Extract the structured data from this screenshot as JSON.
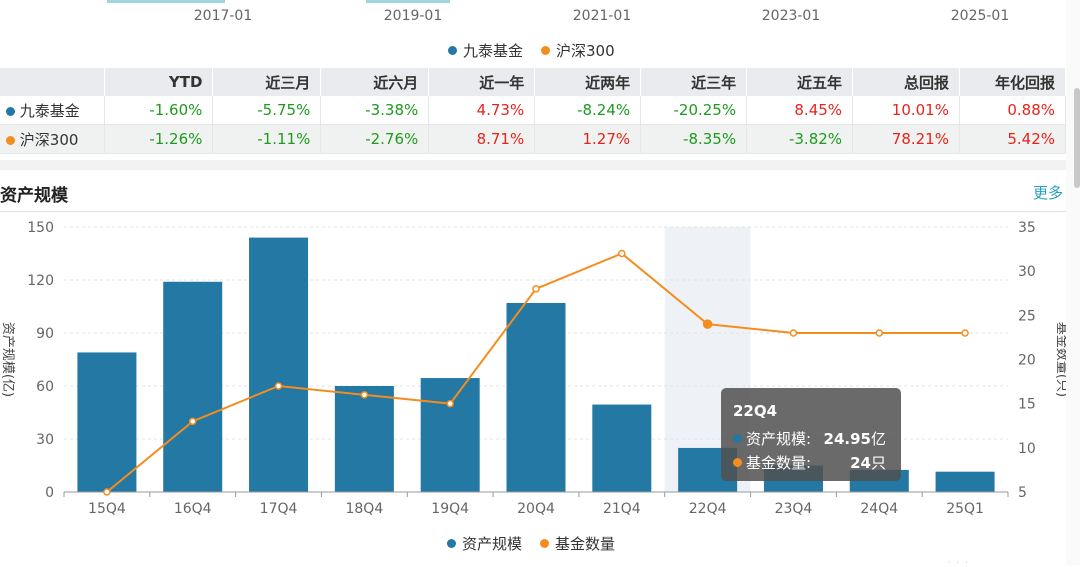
{
  "top_axis": {
    "ticks": [
      "2017-01",
      "2019-01",
      "2021-01",
      "2023-01",
      "2025-01"
    ]
  },
  "perf_legend": [
    {
      "label": "九泰基金",
      "color": "#2378a4"
    },
    {
      "label": "沪深300",
      "color": "#f48d1f"
    }
  ],
  "perf_table": {
    "headers": [
      "YTD",
      "近三月",
      "近六月",
      "近一年",
      "近两年",
      "近三年",
      "近五年",
      "总回报",
      "年化回报"
    ],
    "rows": [
      {
        "name": "九泰基金",
        "color": "#2378a4",
        "values": [
          "-1.60%",
          "-5.75%",
          "-3.38%",
          "4.73%",
          "-8.24%",
          "-20.25%",
          "8.45%",
          "10.01%",
          "0.88%"
        ]
      },
      {
        "name": "沪深300",
        "color": "#f48d1f",
        "values": [
          "-1.26%",
          "-1.11%",
          "-2.76%",
          "8.71%",
          "1.27%",
          "-8.35%",
          "-3.82%",
          "78.21%",
          "5.42%"
        ]
      }
    ]
  },
  "section": {
    "title": "资产规模",
    "more": "更多"
  },
  "chart_data": {
    "type": "bar",
    "categories": [
      "15Q4",
      "16Q4",
      "17Q4",
      "18Q4",
      "19Q4",
      "20Q4",
      "21Q4",
      "22Q4",
      "23Q4",
      "24Q4",
      "25Q1"
    ],
    "series": [
      {
        "name": "资产规模",
        "type": "bar",
        "axis": "left",
        "color": "#2378a4",
        "values": [
          79,
          119,
          144,
          60,
          64.5,
          107,
          49.5,
          24.95,
          15,
          12.5,
          11.5
        ]
      },
      {
        "name": "基金数量",
        "type": "line",
        "axis": "right",
        "color": "#f48d1f",
        "values": [
          5,
          13,
          17,
          16,
          15,
          28,
          32,
          24,
          23,
          23,
          23
        ]
      }
    ],
    "ylabel": "资产规模(亿)",
    "y2label": "基金数量(只)",
    "ylim": [
      0,
      150
    ],
    "y_ticks": [
      "0",
      "30",
      "60",
      "90",
      "120",
      "150"
    ],
    "y2lim": [
      5,
      35
    ],
    "y2_ticks": [
      "5",
      "10",
      "15",
      "20",
      "25",
      "30",
      "35"
    ],
    "highlight_category": "22Q4",
    "grid": true,
    "legend": "bottom-center"
  },
  "tooltip": {
    "title": "22Q4",
    "rows": [
      {
        "label": "资产规模:",
        "value": "24.95",
        "unit": "亿",
        "color": "#2378a4"
      },
      {
        "label": "基金数量:",
        "value": "24",
        "unit": "只",
        "color": "#f48d1f"
      }
    ]
  }
}
